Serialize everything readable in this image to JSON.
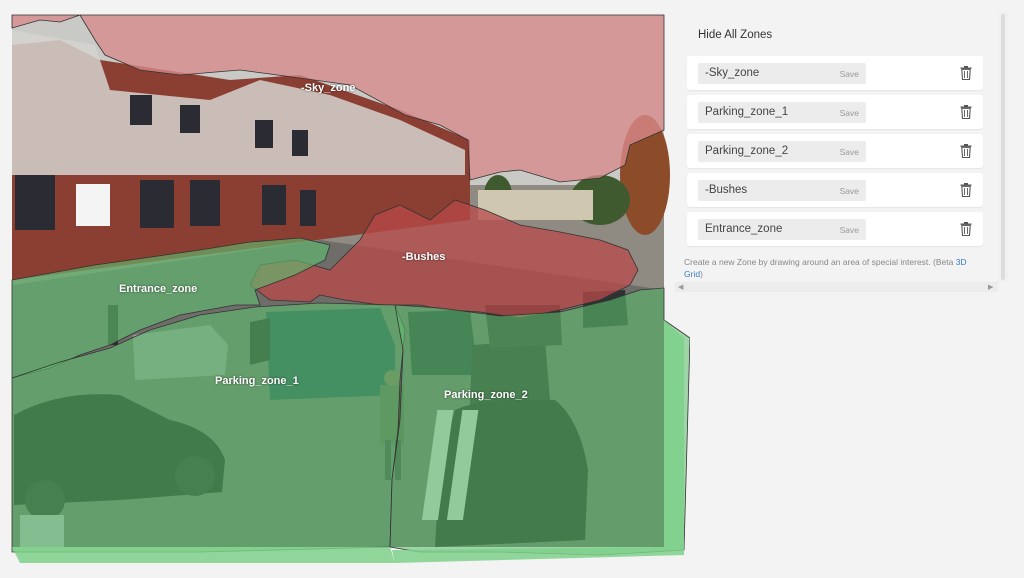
{
  "camera": {
    "zone_labels": {
      "sky": "-Sky_zone",
      "bushes": "-Bushes",
      "entrance": "Entrance_zone",
      "parking1": "Parking_zone_1",
      "parking2": "Parking_zone_2"
    },
    "colors": {
      "sky_overlay": "#d98a8a",
      "bushes_overlay": "#b84a4a",
      "ground_overlay": "#5fbf6f"
    }
  },
  "panel": {
    "hide_all_label": "Hide All Zones",
    "zones": [
      {
        "name": "-Sky_zone",
        "save": "Save"
      },
      {
        "name": "Parking_zone_1",
        "save": "Save"
      },
      {
        "name": "Parking_zone_2",
        "save": "Save"
      },
      {
        "name": "-Bushes",
        "save": "Save"
      },
      {
        "name": "Entrance_zone",
        "save": "Save"
      }
    ],
    "helper_text": "Create a new Zone by drawing around an area of special interest. (Beta",
    "helper_link": "3D Grid",
    "helper_tail": ")",
    "icons": {
      "delete": "trash-icon",
      "scroll_left": "arrow-left-icon",
      "scroll_right": "arrow-right-icon"
    }
  }
}
